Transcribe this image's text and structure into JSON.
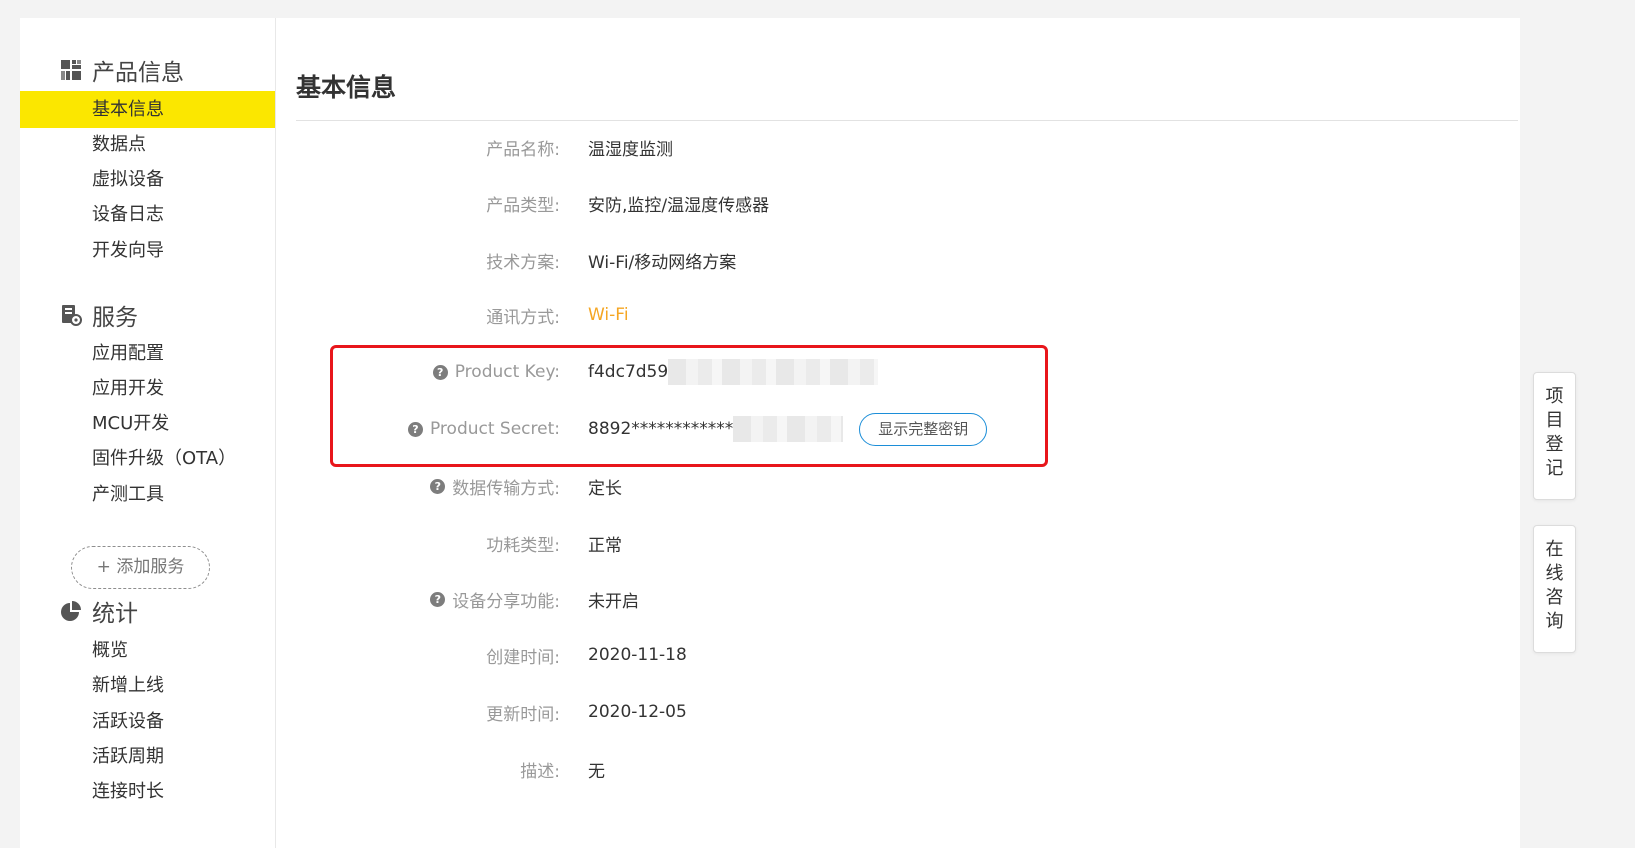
{
  "sidebar": {
    "sections": [
      {
        "title": "产品信息",
        "icon": "grid-icon"
      },
      {
        "title": "服务",
        "icon": "service-gear-icon"
      },
      {
        "title": "统计",
        "icon": "pie-chart-icon"
      }
    ],
    "product_items": [
      "基本信息",
      "数据点",
      "虚拟设备",
      "设备日志",
      "开发向导"
    ],
    "service_items": [
      "应用配置",
      "应用开发",
      "MCU开发",
      "固件升级（OTA）",
      "产测工具"
    ],
    "add_service": "+ 添加服务",
    "stats_items": [
      "概览",
      "新增上线",
      "活跃设备",
      "活跃周期",
      "连接时长"
    ],
    "active": "基本信息"
  },
  "main": {
    "title": "基本信息",
    "fields": [
      {
        "label": "产品名称:",
        "value": "温湿度监测",
        "help": false
      },
      {
        "label": "产品类型:",
        "value": "安防,监控/温湿度传感器",
        "help": false
      },
      {
        "label": "技术方案:",
        "value": "Wi-Fi/移动网络方案",
        "help": false
      },
      {
        "label": "通讯方式:",
        "value": "Wi-Fi",
        "help": false,
        "color": "#f5a623"
      },
      {
        "label": "Product Key:",
        "value": "f4dc7d59",
        "help": true
      },
      {
        "label": "Product Secret:",
        "value": "8892************",
        "help": true
      },
      {
        "label": "数据传输方式:",
        "value": "定长",
        "help": true
      },
      {
        "label": "功耗类型:",
        "value": "正常",
        "help": false
      },
      {
        "label": "设备分享功能:",
        "value": "未开启",
        "help": true
      },
      {
        "label": "创建时间:",
        "value": "2020-11-18",
        "help": false
      },
      {
        "label": "更新时间:",
        "value": "2020-12-05",
        "help": false
      },
      {
        "label": "描述:",
        "value": "无",
        "help": false
      }
    ],
    "reveal_button": "显示完整密钥"
  },
  "float_buttons": [
    {
      "chars": [
        "项",
        "目",
        "登",
        "记"
      ]
    },
    {
      "chars": [
        "在",
        "线",
        "咨",
        "询"
      ]
    }
  ],
  "colors": {
    "active_bg": "#fbe700",
    "highlight": "#e8161b",
    "link_blue": "#1c8ed8",
    "accent_orange": "#f5a623"
  }
}
